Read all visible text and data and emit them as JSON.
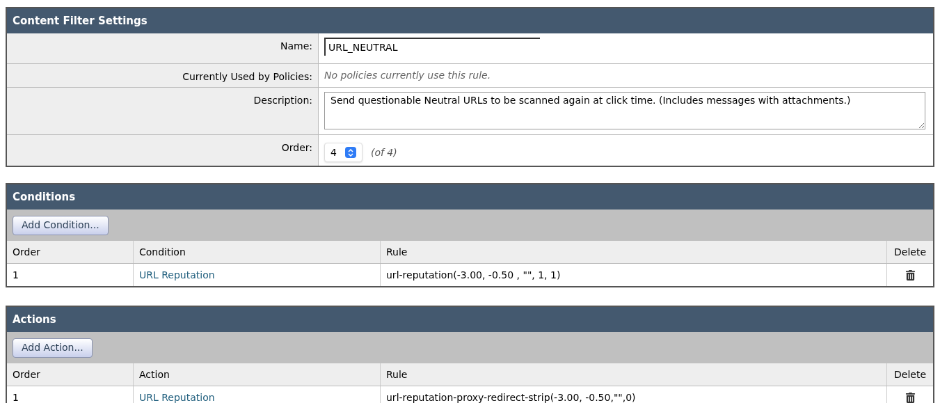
{
  "settings": {
    "title": "Content Filter Settings",
    "fields": [
      {
        "kind": "text",
        "label": "Name:",
        "value": "URL_NEUTRAL"
      },
      {
        "kind": "note",
        "label": "Currently Used by Policies:",
        "value": "No policies currently use this rule."
      },
      {
        "kind": "textarea",
        "label": "Description:",
        "value": "Send questionable Neutral URLs to be scanned again at click time. (Includes messages with attachments.)"
      },
      {
        "kind": "select",
        "label": "Order:",
        "value": "4",
        "suffix": "(of 4)"
      }
    ]
  },
  "tables": [
    {
      "title": "Conditions",
      "button": "Add Condition...",
      "columns": [
        "Order",
        "Condition",
        "Rule",
        "Delete"
      ],
      "rows": [
        {
          "order": "1",
          "name": "URL Reputation",
          "rule": "url-reputation(-3.00, -0.50 , \"\", 1, 1)"
        }
      ]
    },
    {
      "title": "Actions",
      "button": "Add Action...",
      "columns": [
        "Order",
        "Action",
        "Rule",
        "Delete"
      ],
      "rows": [
        {
          "order": "1",
          "name": "URL Reputation",
          "rule": "url-reputation-proxy-redirect-strip(-3.00, -0.50,\"\",0)"
        }
      ]
    }
  ]
}
